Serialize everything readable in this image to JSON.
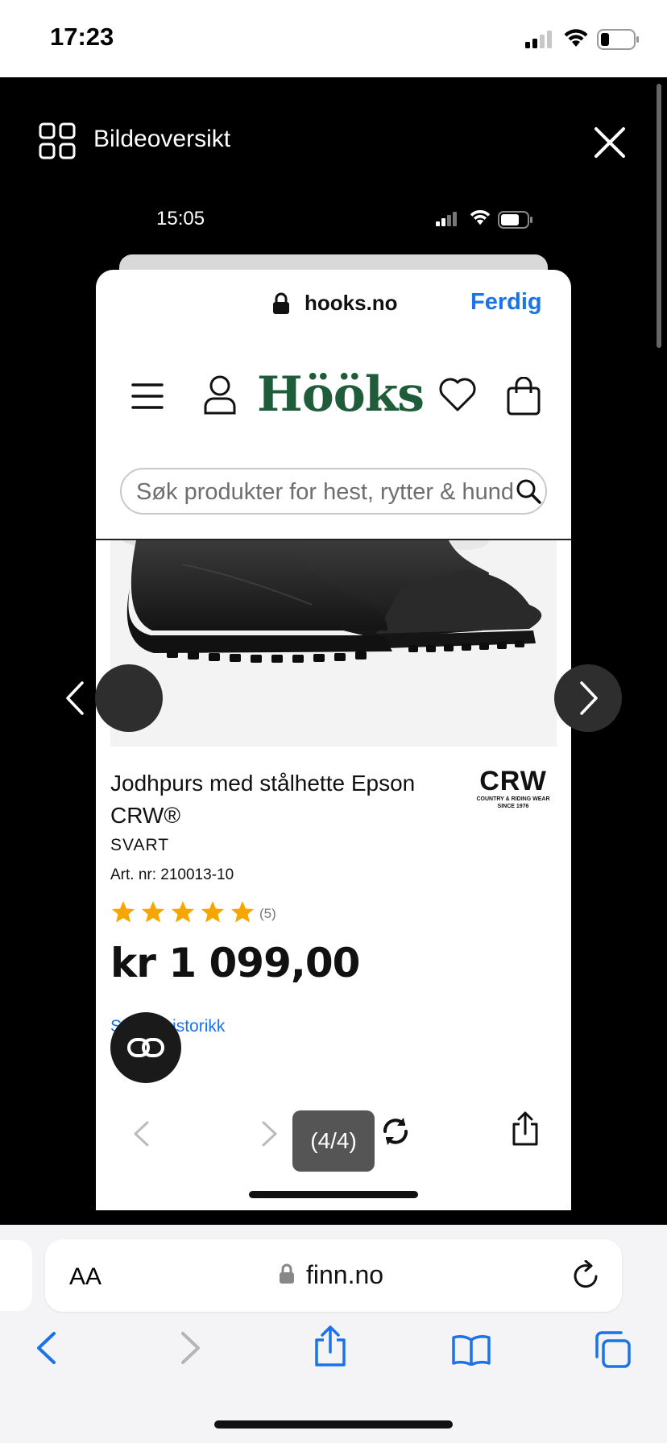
{
  "status": {
    "time": "17:23"
  },
  "viewer": {
    "title": "Bildeoversikt"
  },
  "inner_status": {
    "time": "15:05"
  },
  "inner_browser": {
    "host": "hooks.no",
    "done_label": "Ferdig"
  },
  "site": {
    "logo": "Hööks",
    "search_placeholder": "Søk produkter for hest, rytter & hund"
  },
  "product": {
    "title": "Jodhpurs med stålhette Epson CRW®",
    "brand": "CRW",
    "brand_tagline": "COUNTRY & RIDING WEAR SINCE 1976",
    "color": "SVART",
    "art_nr": "Art. nr: 210013-10",
    "rating": 5,
    "review_count": "(5)",
    "price": "kr 1 099,00",
    "history_link": "Se prishistorikk"
  },
  "pager": {
    "label": "(4/4)"
  },
  "safari": {
    "text_size": "AA",
    "host": "finn.no"
  },
  "colors": {
    "accent": "#1a73e8",
    "logo_green": "#1f5c3a",
    "star": "#f5a700"
  }
}
